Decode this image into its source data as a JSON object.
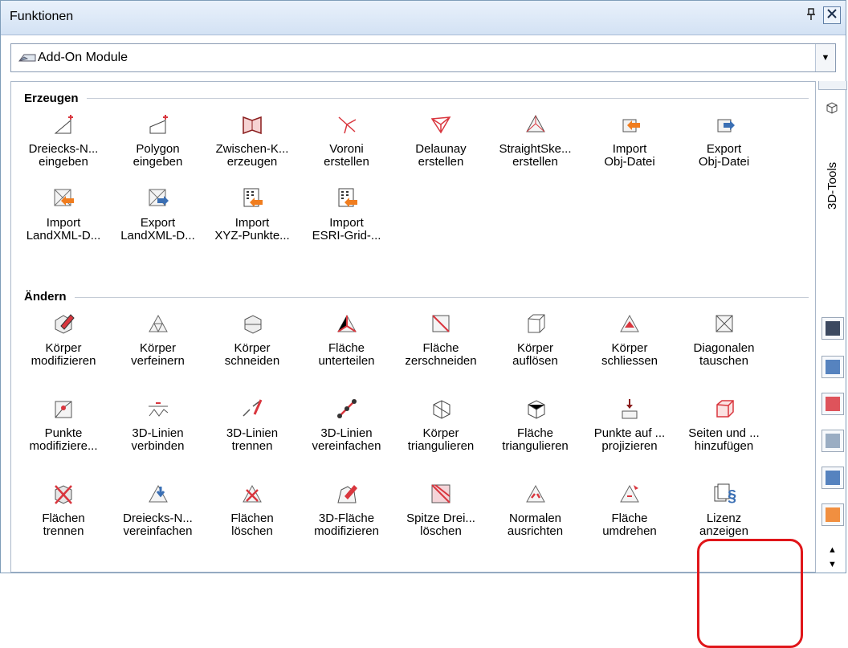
{
  "window": {
    "title": "Funktionen",
    "pin_icon": "pin-icon",
    "close_icon": "close-icon"
  },
  "dropdown": {
    "value": "Add-On Module",
    "icon": "add-on-module-icon"
  },
  "groups": {
    "erzeugen": {
      "title": "Erzeugen",
      "tools": [
        {
          "label": "Dreiecks-N...\neingeben",
          "icon": "triangle-input-icon"
        },
        {
          "label": "Polygon\neingeben",
          "icon": "polygon-input-icon"
        },
        {
          "label": "Zwischen-K...\nerzeugen",
          "icon": "intermediate-create-icon"
        },
        {
          "label": "Voroni\nerstellen",
          "icon": "voronoi-icon"
        },
        {
          "label": "Delaunay\nerstellen",
          "icon": "delaunay-icon"
        },
        {
          "label": "StraightSke...\nerstellen",
          "icon": "straight-skeleton-icon"
        },
        {
          "label": "Import\nObj-Datei",
          "icon": "import-obj-icon"
        },
        {
          "label": "Export\nObj-Datei",
          "icon": "export-obj-icon"
        },
        {
          "label": "Import\nLandXML-D...",
          "icon": "import-landxml-icon"
        },
        {
          "label": "Export\nLandXML-D...",
          "icon": "export-landxml-icon"
        },
        {
          "label": "Import\nXYZ-Punkte...",
          "icon": "import-xyz-icon"
        },
        {
          "label": "Import\nESRI-Grid-...",
          "icon": "import-esri-icon"
        }
      ]
    },
    "aendern": {
      "title": "Ändern",
      "tools": [
        {
          "label": "Körper\nmodifizieren",
          "icon": "body-modify-icon"
        },
        {
          "label": "Körper\nverfeinern",
          "icon": "body-refine-icon"
        },
        {
          "label": "Körper\nschneiden",
          "icon": "body-cut-icon"
        },
        {
          "label": "Fläche\nunterteilen",
          "icon": "face-subdivide-icon"
        },
        {
          "label": "Fläche\nzerschneiden",
          "icon": "face-slice-icon"
        },
        {
          "label": "Körper\nauflösen",
          "icon": "body-dissolve-icon"
        },
        {
          "label": "Körper\nschliessen",
          "icon": "body-close-icon"
        },
        {
          "label": "Diagonalen\ntauschen",
          "icon": "swap-diagonals-icon"
        },
        {
          "label": "Punkte\nmodifiziere...",
          "icon": "points-modify-icon"
        },
        {
          "label": "3D-Linien\nverbinden",
          "icon": "lines-join-icon"
        },
        {
          "label": "3D-Linien\ntrennen",
          "icon": "lines-split-icon"
        },
        {
          "label": "3D-Linien\nvereinfachen",
          "icon": "lines-simplify-icon"
        },
        {
          "label": "Körper\ntriangulieren",
          "icon": "body-triangulate-icon"
        },
        {
          "label": "Fläche\ntriangulieren",
          "icon": "face-triangulate-icon"
        },
        {
          "label": "Punkte auf ...\nprojizieren",
          "icon": "points-project-icon"
        },
        {
          "label": "Seiten und ...\nhinzufügen",
          "icon": "add-sides-icon"
        },
        {
          "label": "Flächen\ntrennen",
          "icon": "faces-separate-icon"
        },
        {
          "label": "Dreiecks-N...\nvereinfachen",
          "icon": "triangle-simplify-icon"
        },
        {
          "label": "Flächen\nlöschen",
          "icon": "faces-delete-icon"
        },
        {
          "label": "3D-Fläche\nmodifizieren",
          "icon": "face3d-modify-icon"
        },
        {
          "label": "Spitze Drei...\nlöschen",
          "icon": "sharp-triangles-delete-icon"
        },
        {
          "label": "Normalen\nausrichten",
          "icon": "align-normals-icon"
        },
        {
          "label": "Fläche\numdrehen",
          "icon": "face-flip-icon"
        },
        {
          "label": "Lizenz\nanzeigen",
          "icon": "license-icon"
        }
      ]
    }
  },
  "side_panel": {
    "label": "3D-Tools",
    "buttons": [
      "layout-icon",
      "terrain-icon",
      "triangle-tool-icon",
      "hatch-icon",
      "crane-icon",
      "export-tool-icon"
    ]
  },
  "colors": {
    "highlight": "#e0161a",
    "titlebar": "#d3e2f4",
    "orange": "#f07d1f",
    "blue": "#3a6fb4"
  }
}
